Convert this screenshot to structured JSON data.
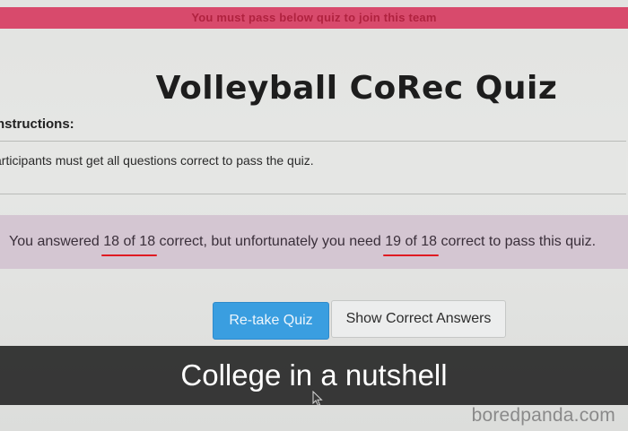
{
  "banner": {
    "text": "You must pass below quiz to join this team"
  },
  "quiz": {
    "title": "Volleyball CoRec Quiz",
    "instructions_label": "nstructions:",
    "instructions_text": "articipants must get all questions correct to pass the quiz."
  },
  "result": {
    "part1": "You answered ",
    "score": "18 of 18",
    "part2": " correct, but unfortunately you need ",
    "required": "19 of 18",
    "part3": " correct to pass this quiz."
  },
  "buttons": {
    "retake_label": "Re-take Quiz",
    "show_answers_label": "Show Correct Answers"
  },
  "caption": {
    "text": "College in a nutshell"
  },
  "watermark": {
    "text": "boredpanda.com"
  },
  "colors": {
    "banner": "#d84a6c",
    "result_bg": "#d4c6d2",
    "primary_button": "#3a9ee0",
    "underline": "#e01a22"
  },
  "icons": {
    "cursor": "mouse-pointer-icon"
  }
}
